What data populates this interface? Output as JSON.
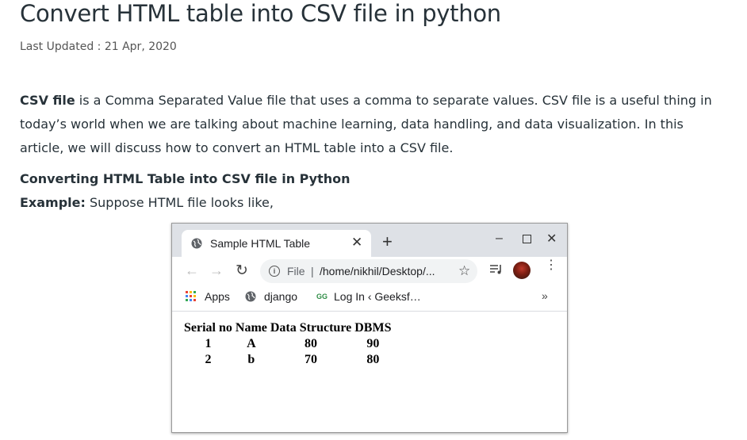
{
  "article": {
    "title": "Convert HTML table into CSV file in python",
    "last_updated_label": "Last Updated : ",
    "last_updated_date": "21 Apr, 2020",
    "intro_bold": "CSV file",
    "intro_rest": " is a Comma Separated Value file that uses a comma to separate values. CSV file is a useful thing in today’s world when we are talking about machine learning, data handling, and data visualization. In this article, we will discuss how to convert an HTML table into a CSV file.",
    "subheading": "Converting HTML Table into CSV file in Python",
    "example_label": "Example:",
    "example_text": " Suppose HTML file looks like,"
  },
  "browser": {
    "tab_title": "Sample HTML Table",
    "tab_close": "✕",
    "new_tab": "+",
    "win_minimize": "–",
    "win_close": "✕",
    "back": "←",
    "forward": "→",
    "reload": "↻",
    "omnibox_scheme": "File",
    "omnibox_separator": "|",
    "omnibox_url": "/home/nikhil/Desktop/...",
    "star": "☆",
    "menu": "⋮",
    "bookmarks": {
      "apps": "Apps",
      "django": "django",
      "geeks_icon": "GG",
      "geeks": "Log In ‹ Geeksf…",
      "more": "»"
    },
    "icons": {
      "favicon": "globe-icon",
      "info": "info-icon",
      "avatar": "profile-avatar"
    },
    "colors": {
      "tabstrip": "#dee1e6",
      "omnibox": "#f1f3f4",
      "apps_grid": [
        "#ea4335",
        "#fbbc05",
        "#34a853",
        "#4285f4"
      ]
    }
  },
  "sample_table": {
    "headers": [
      "Serial no",
      "Name",
      "Data Structure",
      "DBMS"
    ],
    "rows": [
      [
        "1",
        "A",
        "80",
        "90"
      ],
      [
        "2",
        "b",
        "70",
        "80"
      ]
    ]
  }
}
